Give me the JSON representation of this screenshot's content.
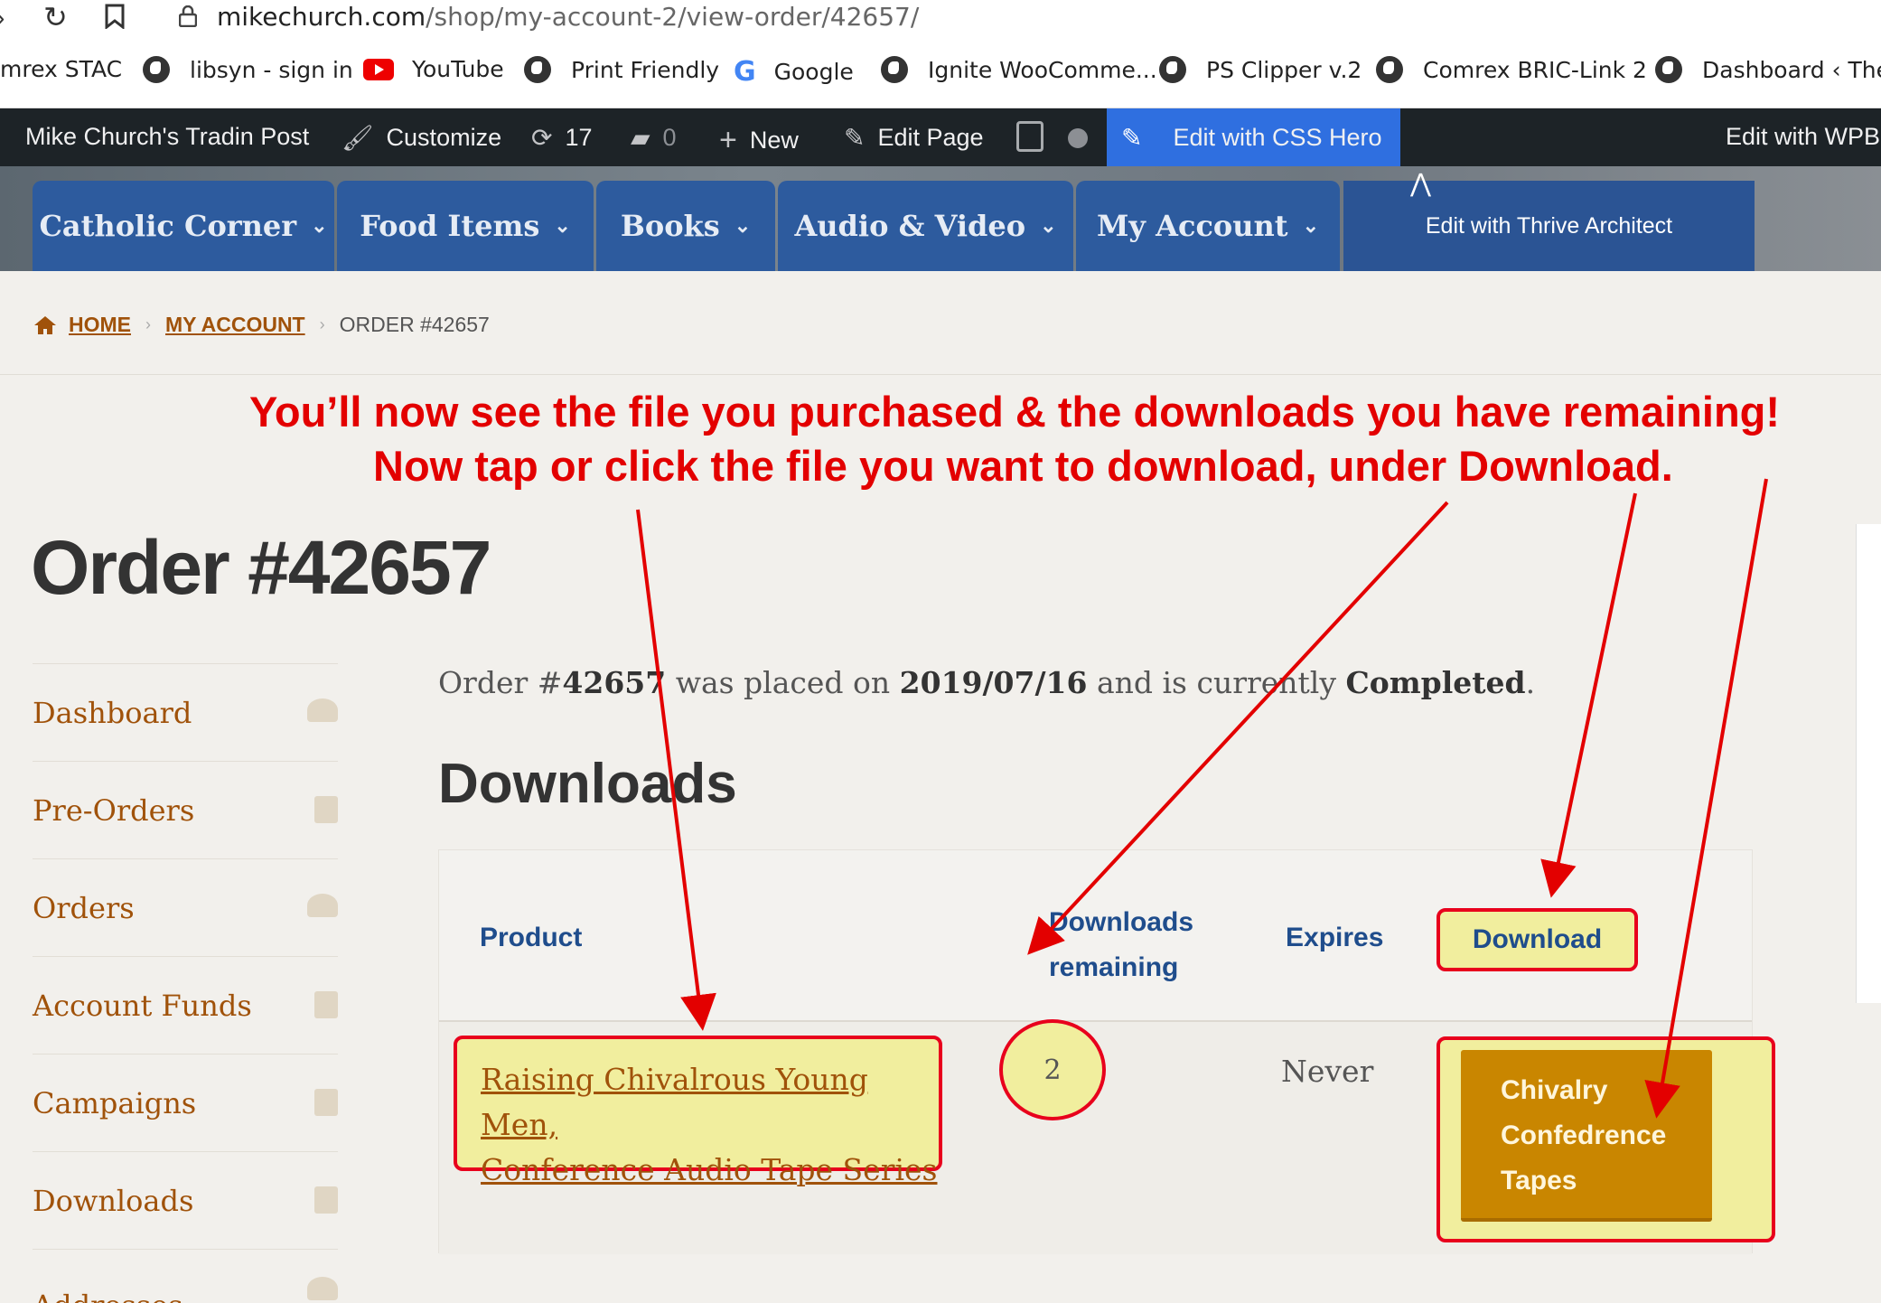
{
  "browser": {
    "url_host": "mikechurch.com",
    "url_path": "/shop/my-account-2/view-order/42657/",
    "bookmarks": [
      "mrex STAC",
      "libsyn - sign in",
      "YouTube",
      "Print Friendly",
      "Google",
      "Ignite WooComme...",
      "PS Clipper v.2",
      "Comrex BRIC-Link 2",
      "Dashboard ‹ The..."
    ]
  },
  "adminbar": {
    "site": "Mike Church's Tradin Post",
    "customize": "Customize",
    "updates": "17",
    "comments": "0",
    "new": "New",
    "edit_page": "Edit Page",
    "css_hero": "Edit with CSS Hero",
    "wpbakery": "Edit with WPBa"
  },
  "menu": {
    "items": [
      "Catholic Corner",
      "Food Items",
      "Books",
      "Audio & Video",
      "My Account"
    ],
    "thrive": "Edit with Thrive Architect"
  },
  "breadcrumb": {
    "home": "HOME",
    "account": "MY ACCOUNT",
    "current": "ORDER #42657"
  },
  "annotations": {
    "line1": "You’ll now see the file you purchased & the downloads you have remaining!",
    "line2": "Now tap or click the file you want to download, under Download."
  },
  "page": {
    "title": "Order #42657",
    "info_prefix": "Order #",
    "order_number": "42657",
    "info_mid": " was placed on ",
    "date": "2019/07/16",
    "info_mid2": " and is currently ",
    "status": "Completed",
    "info_end": ".",
    "downloads_heading": "Downloads"
  },
  "sidebar": {
    "items": [
      "Dashboard",
      "Pre-Orders",
      "Orders",
      "Account Funds",
      "Campaigns",
      "Downloads",
      "Addresses"
    ]
  },
  "table": {
    "headers": {
      "product": "Product",
      "remaining_1": "Downloads",
      "remaining_2": "remaining",
      "expires": "Expires",
      "download": "Download"
    },
    "row": {
      "product_1": "Raising Chivalrous Young Men,",
      "product_2": "Conference Audio Tape Series",
      "remaining": "2",
      "expires": "Never",
      "file_1": "Chivalry",
      "file_2": "Confedrence",
      "file_3": "Tapes"
    }
  },
  "colors": {
    "annotation": "#e30000",
    "highlight": "#f1ee9e",
    "menu": "#2d5b9e",
    "link": "#a0520a",
    "button": "#c98600"
  }
}
